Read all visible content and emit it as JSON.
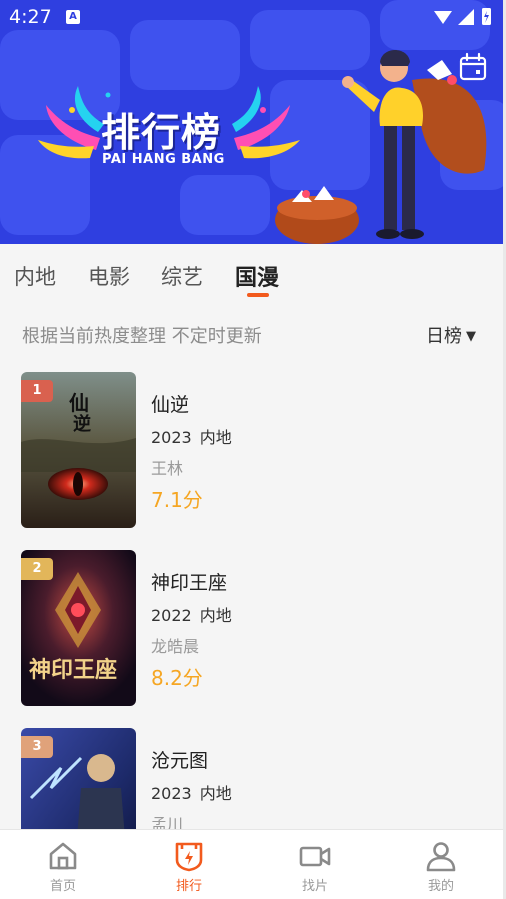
{
  "status_bar": {
    "time": "4:27",
    "notification": "A"
  },
  "banner": {
    "title": "排行榜",
    "subtitle": "PAI HANG BANG",
    "calendar_icon": "calendar-icon"
  },
  "tabs": [
    {
      "label": "内地",
      "active": false
    },
    {
      "label": "电影",
      "active": false
    },
    {
      "label": "综艺",
      "active": false
    },
    {
      "label": "国漫",
      "active": true
    }
  ],
  "subheader": {
    "description": "根据当前热度整理 不定时更新",
    "rank_type": "日榜",
    "caret": "▼"
  },
  "items": [
    {
      "rank": "1",
      "title": "仙逆",
      "year": "2023",
      "region": "内地",
      "author": "王林",
      "score": "7.1分",
      "badge_color": "#d9614f"
    },
    {
      "rank": "2",
      "title": "神印王座",
      "year": "2022",
      "region": "内地",
      "author": "龙皓晨",
      "score": "8.2分",
      "badge_color": "#e2b65a"
    },
    {
      "rank": "3",
      "title": "沧元图",
      "year": "2023",
      "region": "内地",
      "author": "孟川",
      "score": "",
      "badge_color": "#e0a27a"
    }
  ],
  "bottom_nav": [
    {
      "label": "首页",
      "icon": "home-icon",
      "active": false
    },
    {
      "label": "排行",
      "icon": "ranking-shield-icon",
      "active": true
    },
    {
      "label": "找片",
      "icon": "video-camera-icon",
      "active": false
    },
    {
      "label": "我的",
      "icon": "user-icon",
      "active": false
    }
  ],
  "colors": {
    "accent": "#f25a1d",
    "score": "#f5a623",
    "banner": "#2f3fe0"
  }
}
